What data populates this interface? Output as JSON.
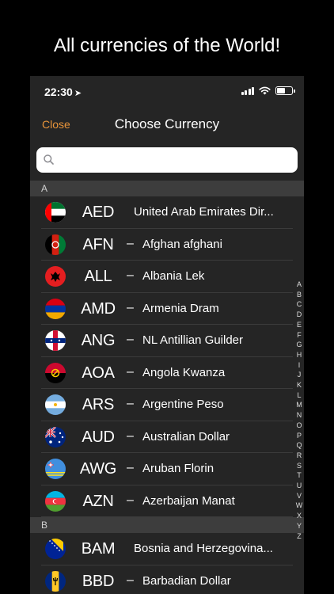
{
  "promo": {
    "caption": "All currencies of the World!"
  },
  "status": {
    "time": "22:30"
  },
  "navbar": {
    "close_label": "Close",
    "title": "Choose Currency"
  },
  "search": {
    "placeholder": "",
    "value": ""
  },
  "sections": [
    {
      "letter": "A",
      "rows": [
        {
          "code": "AED",
          "name": "United Arab Emirates Dir...",
          "dash": false,
          "flag": "uae-flag-icon"
        },
        {
          "code": "AFN",
          "name": "Afghan afghani",
          "dash": true,
          "flag": "afghanistan-flag-icon"
        },
        {
          "code": "ALL",
          "name": "Albania Lek",
          "dash": true,
          "flag": "albania-flag-icon"
        },
        {
          "code": "AMD",
          "name": "Armenia Dram",
          "dash": true,
          "flag": "armenia-flag-icon"
        },
        {
          "code": "ANG",
          "name": "NL Antillian Guilder",
          "dash": true,
          "flag": "netherlands-antilles-flag-icon"
        },
        {
          "code": "AOA",
          "name": "Angola Kwanza",
          "dash": true,
          "flag": "angola-flag-icon"
        },
        {
          "code": "ARS",
          "name": "Argentine Peso",
          "dash": true,
          "flag": "argentina-flag-icon"
        },
        {
          "code": "AUD",
          "name": "Australian Dollar",
          "dash": true,
          "flag": "australia-flag-icon"
        },
        {
          "code": "AWG",
          "name": "Aruban Florin",
          "dash": true,
          "flag": "aruba-flag-icon"
        },
        {
          "code": "AZN",
          "name": "Azerbaijan Manat",
          "dash": true,
          "flag": "azerbaijan-flag-icon"
        }
      ]
    },
    {
      "letter": "B",
      "rows": [
        {
          "code": "BAM",
          "name": "Bosnia and Herzegovina...",
          "dash": false,
          "flag": "bosnia-flag-icon"
        },
        {
          "code": "BBD",
          "name": "Barbadian Dollar",
          "dash": true,
          "flag": "barbados-flag-icon"
        }
      ]
    }
  ],
  "dash_char": "–",
  "index_letters": [
    "A",
    "B",
    "C",
    "D",
    "E",
    "F",
    "G",
    "H",
    "I",
    "J",
    "K",
    "L",
    "M",
    "N",
    "O",
    "P",
    "Q",
    "R",
    "S",
    "T",
    "U",
    "V",
    "W",
    "X",
    "Y",
    "Z"
  ],
  "colors": {
    "accent": "#e8943a",
    "background": "#252525",
    "section_header": "#3d3d3d"
  }
}
